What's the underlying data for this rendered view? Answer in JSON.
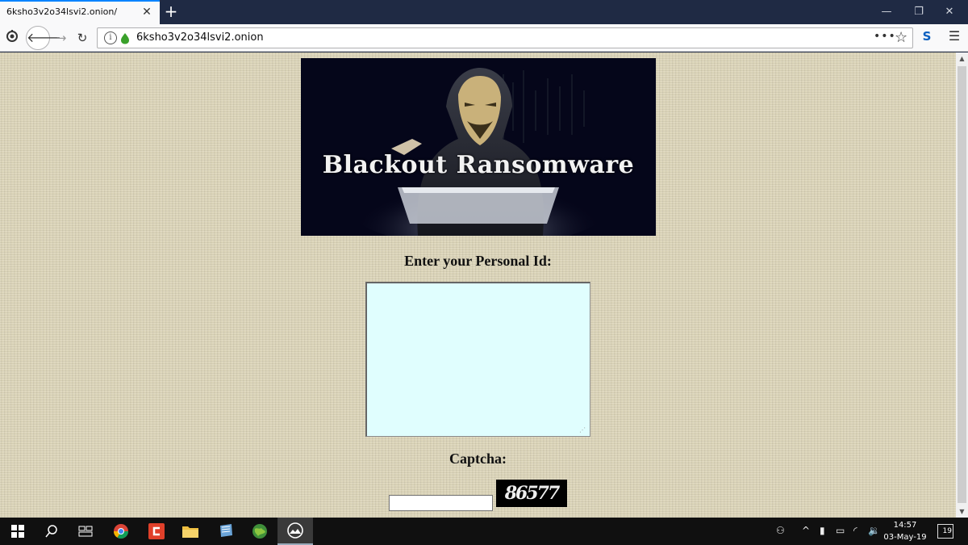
{
  "browser": {
    "tab_title": "6ksho3v2o34lsvi2.onion/",
    "url": "6ksho3v2o34lsvi2.onion"
  },
  "page": {
    "banner_title": "Blackout Ransomware",
    "personal_id_label": "Enter your Personal Id:",
    "captcha_label": "Captcha:",
    "captcha_code": "86577"
  },
  "taskbar": {
    "time": "14:57",
    "date": "03-May-19",
    "notification_count": "19"
  }
}
